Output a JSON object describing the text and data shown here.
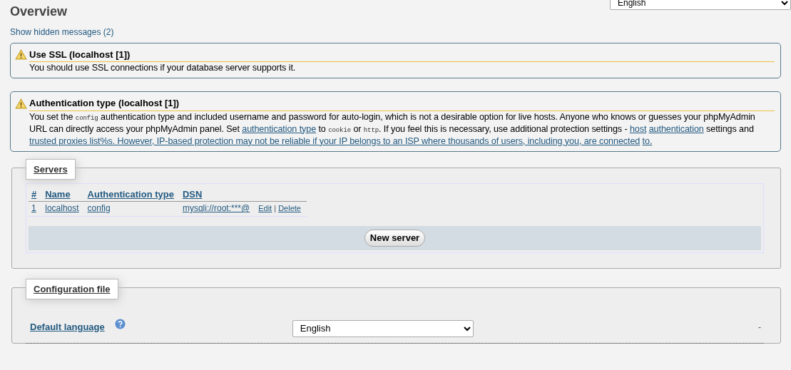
{
  "title": "Overview",
  "language_select": {
    "value": "English"
  },
  "hidden_messages_link": "Show hidden messages (2)",
  "messages": [
    {
      "title": "Use SSL (localhost [1])",
      "body": [
        {
          "kind": "text",
          "text": "You should use SSL connections if your database server supports it."
        }
      ]
    },
    {
      "title": "Authentication type (localhost [1])",
      "body": [
        {
          "kind": "text",
          "text": "You set the "
        },
        {
          "kind": "code",
          "text": "config"
        },
        {
          "kind": "text",
          "text": " authentication type and included username and password for auto-login, which is not a desirable option for live hosts. Anyone who knows or guesses your phpMyAdmin URL can directly access your phpMyAdmin panel. Set "
        },
        {
          "kind": "link",
          "text": "authentication type"
        },
        {
          "kind": "text",
          "text": " to "
        },
        {
          "kind": "code",
          "text": "cookie"
        },
        {
          "kind": "text",
          "text": " or "
        },
        {
          "kind": "code",
          "text": "http"
        },
        {
          "kind": "text",
          "text": ". If you feel this is necessary, use additional protection settings - "
        },
        {
          "kind": "link",
          "text": "host"
        },
        {
          "kind": "space"
        },
        {
          "kind": "link",
          "text": "authentication"
        },
        {
          "kind": "text",
          "text": " settings and "
        },
        {
          "kind": "link",
          "text": "trusted proxies list%s. However, IP-based protection may not be reliable if your IP belongs to an ISP where thousands of users, including you, are connected"
        },
        {
          "kind": "space"
        },
        {
          "kind": "link",
          "text": "to."
        }
      ]
    }
  ],
  "servers": {
    "legend": "Servers",
    "columns": [
      "#",
      "Name",
      "Authentication type",
      "DSN"
    ],
    "rows": [
      {
        "cells": [
          "1",
          "localhost",
          "config",
          "mysqli://root:***@"
        ],
        "actions": [
          "Edit",
          "Delete"
        ],
        "separator": "|"
      }
    ],
    "new_button": "New server"
  },
  "config_file": {
    "legend": "Configuration file",
    "fields": [
      {
        "label": "Default language",
        "value": "English",
        "extra": "-"
      }
    ]
  }
}
